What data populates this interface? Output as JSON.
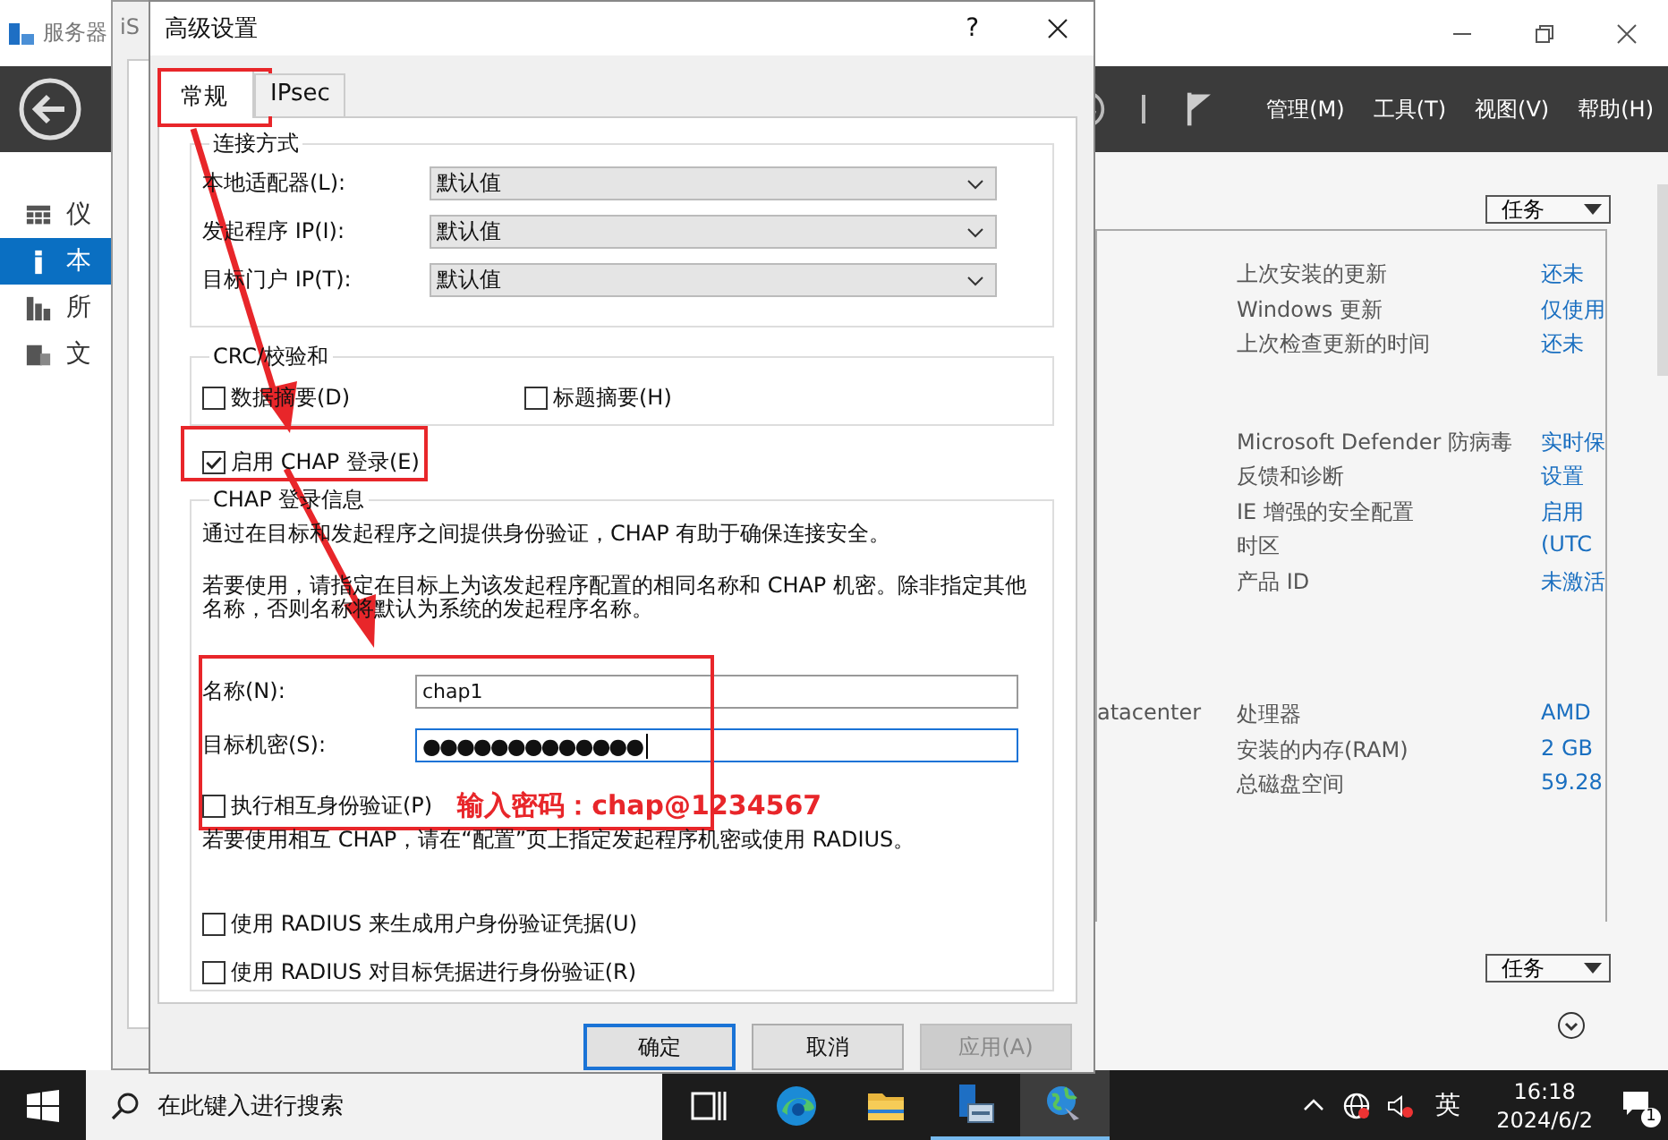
{
  "server_manager": {
    "title": "服务器",
    "menus": [
      "管理(M)",
      "工具(T)",
      "视图(V)",
      "帮助(H)"
    ],
    "sidebar": {
      "items": [
        {
          "label": "仪",
          "kind": "dashboard",
          "selected": false
        },
        {
          "label": "本",
          "kind": "local",
          "selected": true
        },
        {
          "label": "所",
          "kind": "all",
          "selected": false
        },
        {
          "label": "文",
          "kind": "files",
          "selected": false
        }
      ]
    },
    "tasks_top": "任务",
    "tasks_bottom": "任务",
    "property_groups": [
      {
        "rows": [
          {
            "label": "上次安装的更新",
            "value": "还未"
          },
          {
            "label": "Windows 更新",
            "value": "仅使用"
          },
          {
            "label": "上次检查更新的时间",
            "value": "还未"
          }
        ]
      },
      {
        "rows": [
          {
            "label": "Microsoft Defender 防病毒",
            "value": "实时保"
          },
          {
            "label": "反馈和诊断",
            "value": "设置"
          },
          {
            "label": "IE 增强的安全配置",
            "value": "启用"
          },
          {
            "label": "时区",
            "value": "(UTC"
          },
          {
            "label": "产品 ID",
            "value": "未激活"
          }
        ]
      },
      {
        "left": "atacenter",
        "rows": [
          {
            "label": "处理器",
            "value": "AMD"
          },
          {
            "label": "安装的内存(RAM)",
            "value": "2 GB"
          },
          {
            "label": "总磁盘空间",
            "value": "59.28"
          }
        ]
      }
    ]
  },
  "iscsi_window": {
    "title": "iS"
  },
  "dialog": {
    "title": "高级设置",
    "help": "?",
    "tabs": [
      {
        "label": "常规",
        "selected": true
      },
      {
        "label": "IPsec",
        "selected": false
      }
    ],
    "connection": {
      "title": "连接方式",
      "rows": [
        {
          "label": "本地适配器(L):",
          "value": "默认值"
        },
        {
          "label": "发起程序 IP(I):",
          "value": "默认值"
        },
        {
          "label": "目标门户 IP(T):",
          "value": "默认值"
        }
      ]
    },
    "crc": {
      "title": "CRC/校验和",
      "checkboxes": [
        {
          "label": "数据摘要(D)",
          "checked": false
        },
        {
          "label": "标题摘要(H)",
          "checked": false
        }
      ]
    },
    "enable_chap": {
      "label": "启用 CHAP 登录(E)",
      "checked": true
    },
    "chap": {
      "title": "CHAP 登录信息",
      "description": "通过在目标和发起程序之间提供身份验证，CHAP 有助于确保连接安全。",
      "instructions": "若要使用，请指定在目标上为该发起程序配置的相同名称和 CHAP 机密。除非指定其他名称，否则名称将默认为系统的发起程序名称。",
      "name": {
        "label": "名称(N):",
        "value": "chap1"
      },
      "secret": {
        "label": "目标机密(S):",
        "value": "●●●●●●●●●●●●●"
      },
      "mutual": {
        "label": "执行相互身份验证(P)",
        "checked": false
      },
      "mutual_note": "若要使用相互 CHAP，请在“配置”页上指定发起程序机密或使用 RADIUS。",
      "radius": [
        {
          "label": "使用 RADIUS 来生成用户身份验证凭据(U)",
          "checked": false
        },
        {
          "label": "使用 RADIUS 对目标凭据进行身份验证(R)",
          "checked": false
        }
      ]
    },
    "buttons": [
      {
        "label": "确定",
        "kind": "default",
        "disabled": false
      },
      {
        "label": "取消",
        "kind": "normal",
        "disabled": false
      },
      {
        "label": "应用(A)",
        "kind": "normal",
        "disabled": true
      }
    ]
  },
  "annotation": {
    "note": "输入密码：chap@1234567"
  },
  "taskbar": {
    "search": {
      "placeholder": "在此键入进行搜索"
    },
    "apps": [
      {
        "kind": "taskview",
        "running": false,
        "selected": false
      },
      {
        "kind": "browser",
        "running": false,
        "selected": false
      },
      {
        "kind": "folder",
        "running": false,
        "selected": false
      },
      {
        "kind": "server",
        "running": true,
        "selected": false
      },
      {
        "kind": "network",
        "running": true,
        "selected": true
      }
    ],
    "ime": "英",
    "time": "16:18",
    "date": "2024/6/2",
    "notification_count": "1"
  }
}
